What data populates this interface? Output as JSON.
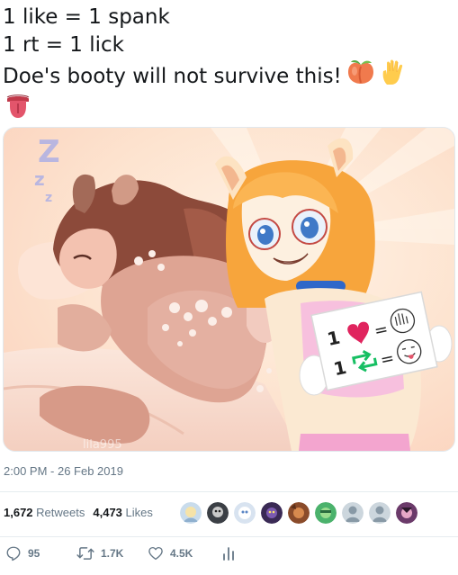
{
  "tweet": {
    "lines": [
      "1 like = 1 spank",
      "1 rt = 1 lick",
      "Doe's booty will not survive this!"
    ],
    "emoji": [
      "peach-emoji",
      "raised-hand-emoji",
      "tongue-emoji"
    ]
  },
  "media": {
    "sign": {
      "row1_num": "1",
      "row1_eq": "=",
      "row2_num": "1",
      "row2_eq": "="
    },
    "watermark": "lila995"
  },
  "meta": {
    "timestamp": "2:00 PM - 26 Feb 2019"
  },
  "stats": {
    "retweets_count": "1,672",
    "retweets_label": "Retweets",
    "likes_count": "4,473",
    "likes_label": "Likes"
  },
  "likers": [
    {
      "name": "avatar-1",
      "color": "#c9dcec"
    },
    {
      "name": "avatar-2",
      "color": "#3b3f45"
    },
    {
      "name": "avatar-3",
      "color": "#d8e3f0"
    },
    {
      "name": "avatar-4",
      "color": "#3a2a55"
    },
    {
      "name": "avatar-5",
      "color": "#8a4b2a"
    },
    {
      "name": "avatar-6",
      "color": "#4bb26c"
    },
    {
      "name": "avatar-7",
      "color": "#ccd6dd"
    },
    {
      "name": "avatar-8",
      "color": "#ccd6dd"
    },
    {
      "name": "avatar-9",
      "color": "#6b3a6a"
    }
  ],
  "actions": {
    "reply_count": "95",
    "retweet_count": "1.7K",
    "like_count": "4.5K"
  },
  "colors": {
    "text_secondary": "#657786",
    "divider": "#e6ecf0",
    "retweet_green": "#17bf63",
    "heart_red": "#e0245e"
  }
}
